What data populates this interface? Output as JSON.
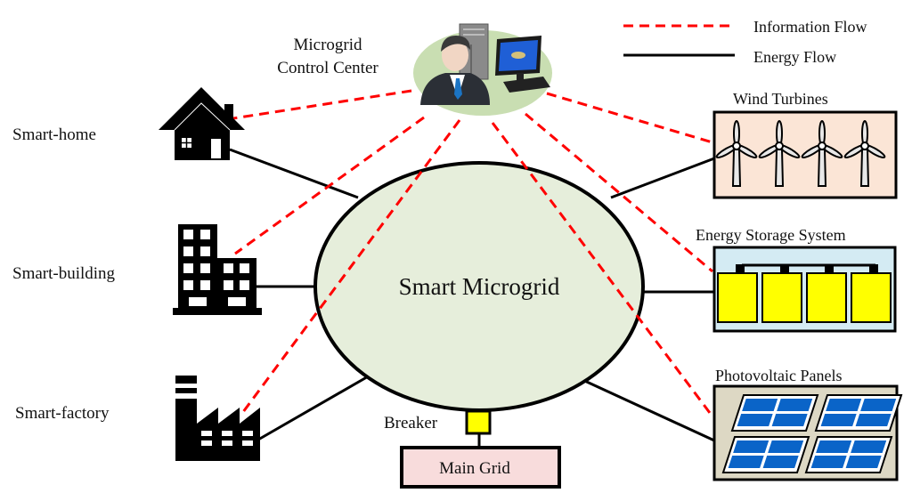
{
  "legend": {
    "information_flow": "Information Flow",
    "energy_flow": "Energy Flow"
  },
  "center": {
    "label": "Smart Microgrid"
  },
  "control_center": {
    "line1": "Microgrid",
    "line2": "Control Center"
  },
  "consumers": [
    {
      "id": "home",
      "label": "Smart-home",
      "icon": "house-icon"
    },
    {
      "id": "building",
      "label": "Smart-building",
      "icon": "building-icon"
    },
    {
      "id": "factory",
      "label": "Smart-factory",
      "icon": "factory-icon"
    }
  ],
  "sources": [
    {
      "id": "wind",
      "label": "Wind Turbines",
      "icon": "wind-turbine-icon",
      "count": 4
    },
    {
      "id": "storage",
      "label": "Energy Storage System",
      "icon": "battery-icon",
      "count": 4
    },
    {
      "id": "pv",
      "label": "Photovoltaic Panels",
      "icon": "solar-panel-icon",
      "count": 4
    }
  ],
  "breaker": {
    "label": "Breaker"
  },
  "main_grid": {
    "label": "Main Grid"
  },
  "colors": {
    "information_flow": "#ff0000",
    "energy_flow": "#000000",
    "microgrid_fill": "#e6eedb",
    "control_center_fill": "#c9deb2",
    "wind_box_fill": "#fbe5d6",
    "storage_box_fill": "#d4ebf3",
    "battery_fill": "#ffff00",
    "pv_box_fill": "#ddd8c4",
    "pv_cell_fill": "#0066cc",
    "main_grid_fill": "#f8dcdc",
    "breaker_fill": "#ffff00"
  }
}
